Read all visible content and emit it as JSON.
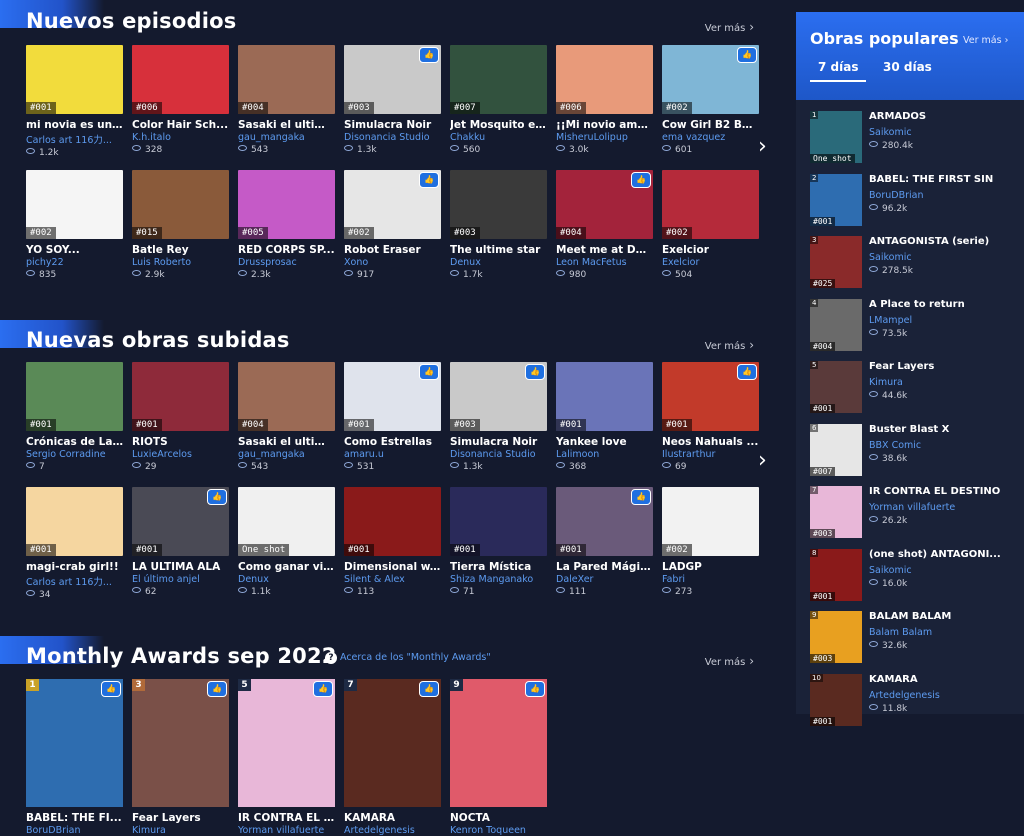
{
  "sections": [
    {
      "title": "Nuevos episodios",
      "ver_mas": "Ver más",
      "rows": [
        [
          {
            "title": "mi novia es un...",
            "author": "Carlos art 116力...",
            "views": "1.2k",
            "ep": "#001",
            "badge": false,
            "bg": "#f2dc3c"
          },
          {
            "title": "Color Hair Sch...",
            "author": "K.h.italo",
            "views": "328",
            "ep": "#006",
            "badge": false,
            "bg": "#d7303b"
          },
          {
            "title": "Sasaki el ultim...",
            "author": "gau_mangaka",
            "views": "543",
            "ep": "#004",
            "badge": false,
            "bg": "#9b6a55"
          },
          {
            "title": "Simulacra Noir",
            "author": "Disonancia Studio",
            "views": "1.3k",
            "ep": "#003",
            "badge": true,
            "bg": "#c9c9c9"
          },
          {
            "title": "Jet Mosquito e...",
            "author": "Chakku",
            "views": "560",
            "ep": "#007",
            "badge": false,
            "bg": "#32523e"
          },
          {
            "title": "¡¡Mi novio ame...",
            "author": "MisheruLolipup",
            "views": "3.0k",
            "ep": "#006",
            "badge": false,
            "bg": "#e89a7a"
          },
          {
            "title": "Cow Girl B2 Bu...",
            "author": "ema vazquez",
            "views": "601",
            "ep": "#002",
            "badge": true,
            "bg": "#7fb6d6"
          }
        ],
        [
          {
            "title": "YO SOY...",
            "author": "pichy22",
            "views": "835",
            "ep": "#002",
            "badge": false,
            "bg": "#f5f5f5"
          },
          {
            "title": "Batle Rey",
            "author": "Luis Roberto",
            "views": "2.9k",
            "ep": "#015",
            "badge": false,
            "bg": "#8a5a3a"
          },
          {
            "title": "RED CORPS SP...",
            "author": "Drussprosac",
            "views": "2.3k",
            "ep": "#005",
            "badge": false,
            "bg": "#c55ac7"
          },
          {
            "title": "Robot Eraser",
            "author": "Xono",
            "views": "917",
            "ep": "#002",
            "badge": true,
            "bg": "#e6e6e6"
          },
          {
            "title": "The ultime star",
            "author": "Denux",
            "views": "1.7k",
            "ep": "#003",
            "badge": false,
            "bg": "#3a3a3a"
          },
          {
            "title": "Meet me at Da...",
            "author": "Leon MacFetus",
            "views": "980",
            "ep": "#004",
            "badge": true,
            "bg": "#a3233b"
          },
          {
            "title": "Exelcior",
            "author": "Exelcior",
            "views": "504",
            "ep": "#002",
            "badge": false,
            "bg": "#b52a3a"
          }
        ]
      ]
    },
    {
      "title": "Nuevas obras subidas",
      "ver_mas": "Ver más",
      "rows": [
        [
          {
            "title": "Crónicas de La...",
            "author": "Sergio Corradine",
            "views": "7",
            "ep": "#001",
            "badge": false,
            "bg": "#5a8a57"
          },
          {
            "title": "RIOTS",
            "author": "LuxieArcelos",
            "views": "29",
            "ep": "#001",
            "badge": false,
            "bg": "#8e2a3a"
          },
          {
            "title": "Sasaki el ultim...",
            "author": "gau_mangaka",
            "views": "543",
            "ep": "#004",
            "badge": false,
            "bg": "#9b6a55"
          },
          {
            "title": "Como Estrellas",
            "author": "amaru.u",
            "views": "531",
            "ep": "#001",
            "badge": true,
            "bg": "#dfe3ec"
          },
          {
            "title": "Simulacra Noir",
            "author": "Disonancia Studio",
            "views": "1.3k",
            "ep": "#003",
            "badge": true,
            "bg": "#c9c9c9"
          },
          {
            "title": "Yankee love",
            "author": "Lalimoon",
            "views": "368",
            "ep": "#001",
            "badge": false,
            "bg": "#6a74b8"
          },
          {
            "title": "Neos Nahuals ...",
            "author": "Ilustrarthur",
            "views": "69",
            "ep": "#001",
            "badge": true,
            "bg": "#c23a2a"
          }
        ],
        [
          {
            "title": "magi-crab girl!!",
            "author": "Carlos art 116力...",
            "views": "34",
            "ep": "#001",
            "badge": false,
            "bg": "#f5d6a0"
          },
          {
            "title": "LA ULTIMA ALA",
            "author": "El último anjel",
            "views": "62",
            "ep": "#001",
            "badge": true,
            "bg": "#4a4a55"
          },
          {
            "title": "Como ganar vi...",
            "author": "Denux",
            "views": "1.1k",
            "ep": "One shot",
            "badge": false,
            "bg": "#f0f0f0"
          },
          {
            "title": "Dimensional w...",
            "author": "Silent & Alex",
            "views": "113",
            "ep": "#001",
            "badge": false,
            "bg": "#8a1a1a"
          },
          {
            "title": "Tierra Mística",
            "author": "Shiza Manganako",
            "views": "71",
            "ep": "#001",
            "badge": false,
            "bg": "#2a2a5a"
          },
          {
            "title": "La Pared Mágica",
            "author": "DaleXer",
            "views": "111",
            "ep": "#001",
            "badge": true,
            "bg": "#6a5a7a"
          },
          {
            "title": "LADGP",
            "author": "Fabri",
            "views": "273",
            "ep": "#002",
            "badge": false,
            "bg": "#f2f2f2"
          }
        ]
      ]
    }
  ],
  "awards": {
    "title": "Monthly Awards sep 2022",
    "link": "Acerca de los \"Monthly Awards\"",
    "ver_mas": "Ver más",
    "items": [
      {
        "rank": "1",
        "title": "BABEL: THE FI...",
        "author": "BoruDBrian",
        "bg": "#2e6db0",
        "rank_color": "#c9a227"
      },
      {
        "rank": "3",
        "title": "Fear Layers",
        "author": "Kimura",
        "bg": "#7a5048",
        "rank_color": "#b06a3a"
      },
      {
        "rank": "5",
        "title": "IR CONTRA EL ...",
        "author": "Yorman villafuerte",
        "bg": "#e8b7d8",
        "rank_color": "#1e2a44"
      },
      {
        "rank": "7",
        "title": "KAMARA",
        "author": "Artedelgenesis",
        "bg": "#5a2a20",
        "rank_color": "#1e2a44"
      },
      {
        "rank": "9",
        "title": "NOCTA",
        "author": "Kenron Toqueen",
        "bg": "#e05a6a",
        "rank_color": "#1e2a44"
      }
    ]
  },
  "popular": {
    "title": "Obras populares",
    "ver_mas": "Ver más",
    "tabs": [
      "7 días",
      "30 días"
    ],
    "items": [
      {
        "rank": "1",
        "title": "ARMADOS",
        "author": "Saikomic",
        "views": "280.4k",
        "ep": "One shot",
        "bg": "#2a6a7a"
      },
      {
        "rank": "2",
        "title": "BABEL: THE FIRST SIN",
        "author": "BoruDBrian",
        "views": "96.2k",
        "ep": "#001",
        "bg": "#2e6db0"
      },
      {
        "rank": "3",
        "title": "ANTAGONISTA (serie)",
        "author": "Saikomic",
        "views": "278.5k",
        "ep": "#025",
        "bg": "#8a2a2a"
      },
      {
        "rank": "4",
        "title": "A Place to return",
        "author": "LMampel",
        "views": "73.5k",
        "ep": "#004",
        "bg": "#6a6a6a"
      },
      {
        "rank": "5",
        "title": "Fear Layers",
        "author": "Kimura",
        "views": "44.6k",
        "ep": "#001",
        "bg": "#5a3a3a"
      },
      {
        "rank": "6",
        "title": "Buster Blast X",
        "author": "BBX Comic",
        "views": "38.6k",
        "ep": "#007",
        "bg": "#e6e6e6"
      },
      {
        "rank": "7",
        "title": "IR CONTRA EL DESTINO",
        "author": "Yorman villafuerte",
        "views": "26.2k",
        "ep": "#003",
        "bg": "#e8b7d8"
      },
      {
        "rank": "8",
        "title": "(one shot) ANTAGONI...",
        "author": "Saikomic",
        "views": "16.0k",
        "ep": "#001",
        "bg": "#8a1a1a"
      },
      {
        "rank": "9",
        "title": "BALAM BALAM",
        "author": "Balam Balam",
        "views": "32.6k",
        "ep": "#003",
        "bg": "#e8a020"
      },
      {
        "rank": "10",
        "title": "KAMARA",
        "author": "Artedelgenesis",
        "views": "11.8k",
        "ep": "#001",
        "bg": "#5a2a20"
      }
    ]
  }
}
